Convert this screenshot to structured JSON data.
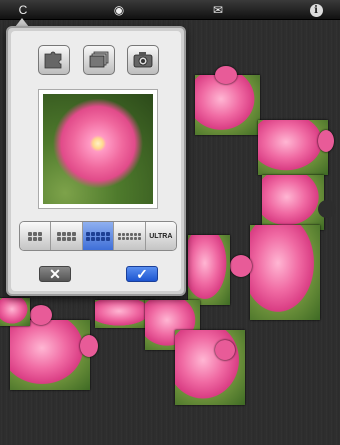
{
  "toolbar": {
    "back_glyph": "C",
    "eye_glyph": "◉",
    "mail_glyph": "✉",
    "info_glyph": "i",
    "icons": [
      "back-arrow-icon",
      "eye-icon",
      "envelope-icon",
      "info-icon"
    ]
  },
  "popover": {
    "sources": [
      {
        "icon": "puzzle-piece-icon"
      },
      {
        "icon": "photo-album-icon"
      },
      {
        "icon": "camera-icon"
      }
    ],
    "difficulty": {
      "options": [
        "",
        "",
        "",
        "",
        "ULTRA"
      ],
      "selected_index": 2
    },
    "cancel_glyph": "✕",
    "confirm_glyph": "✓"
  },
  "colors": {
    "accent_blue": "#3f6fd8",
    "petal_pink": "#f06aa3"
  }
}
